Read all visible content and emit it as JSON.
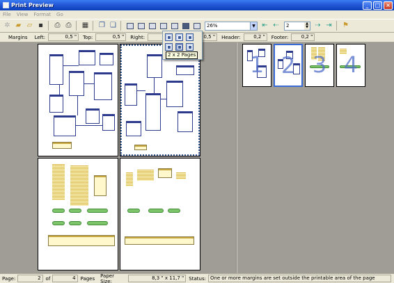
{
  "window": {
    "title": "Print Preview"
  },
  "menu": [
    "File",
    "View",
    "Format",
    "Go"
  ],
  "toolbar": {
    "zoom": "26%",
    "page": "2"
  },
  "margins": {
    "label": "Margins",
    "left_label": "Left:",
    "left": "0,5 \"",
    "top_label": "Top:",
    "top": "0,5 \"",
    "right_label": "Right:",
    "right": "0,5 \"",
    "bottom": "0,5 \"",
    "header_label": "Header:",
    "header": "0,2 \"",
    "footer_label": "Footer:",
    "footer": "0,2 \""
  },
  "layout_popup": {
    "tooltip": "2 x 2 Pages"
  },
  "thumbnails": [
    "1",
    "2",
    "3",
    "4"
  ],
  "status": {
    "page_label": "Page:",
    "page": "2",
    "of_label": "of",
    "total": "4",
    "pages_label": "Pages",
    "paper_label": "Paper Size:",
    "paper": "8,3 \" x 11,7 \"",
    "status_label": "Status:",
    "message": "One or more margins are set outside the printable area of the page"
  },
  "colors": {
    "titlebar": "#2458d8",
    "selection": "#3a6ad4",
    "table_border": "#2b3a8c",
    "pill": "#7dc46a"
  }
}
